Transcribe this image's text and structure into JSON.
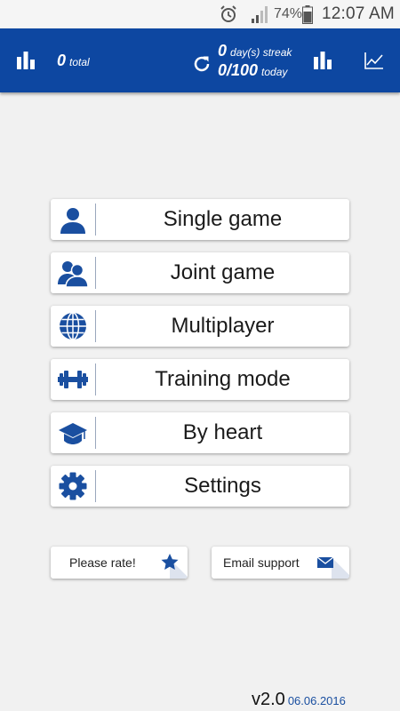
{
  "status_bar": {
    "battery_percent": "74%",
    "time": "12:07 AM",
    "icons": [
      "alarm-icon",
      "signal-icon",
      "battery-icon"
    ]
  },
  "header": {
    "total_count": "0",
    "total_label": "total",
    "streak_count": "0",
    "streak_label": "day(s) streak",
    "today_count": "0/100",
    "today_label": "today",
    "icons": [
      "stats-icon",
      "refresh-icon",
      "bar-chart-icon",
      "trend-chart-icon"
    ],
    "background_color": "#0d47a1"
  },
  "menu": {
    "items": [
      {
        "label": "Single game",
        "icon": "person-icon"
      },
      {
        "label": "Joint game",
        "icon": "people-icon"
      },
      {
        "label": "Multiplayer",
        "icon": "globe-icon"
      },
      {
        "label": "Training mode",
        "icon": "dumbbell-icon"
      },
      {
        "label": "By heart",
        "icon": "graduation-cap-icon"
      },
      {
        "label": "Settings",
        "icon": "gear-icon"
      }
    ]
  },
  "actions": {
    "rate_label": "Please rate!",
    "rate_icon": "star-icon",
    "email_label": "Email support",
    "email_icon": "envelope-icon"
  },
  "footer": {
    "version": "v2.0",
    "date": "06.06.2016"
  },
  "colors": {
    "accent": "#0d47a1",
    "icon_blue": "#1a4fa0",
    "background": "#f1f1f1"
  }
}
